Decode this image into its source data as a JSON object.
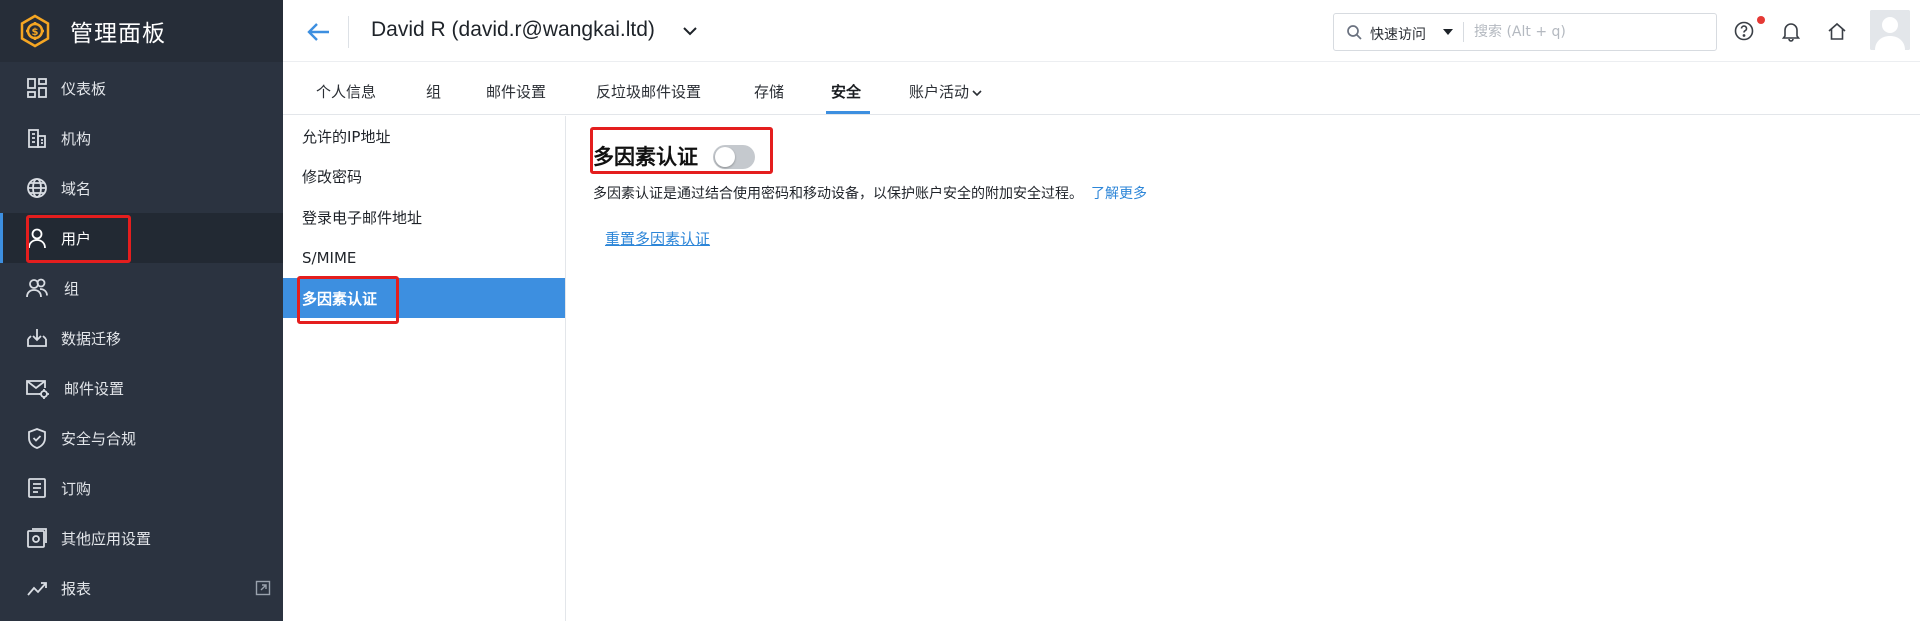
{
  "brand": {
    "title": "管理面板",
    "icon": "admin-panel-gear-icon",
    "accent": "#f5a623"
  },
  "sidebar": {
    "items": [
      {
        "label": "仪表板",
        "icon": "dashboard-icon"
      },
      {
        "label": "机构",
        "icon": "building-icon"
      },
      {
        "label": "域名",
        "icon": "globe-icon"
      },
      {
        "label": "用户",
        "icon": "user-icon",
        "active": true
      },
      {
        "label": "组",
        "icon": "group-icon"
      },
      {
        "label": "数据迁移",
        "icon": "download-tray-icon"
      },
      {
        "label": "邮件设置",
        "icon": "mail-settings-icon"
      },
      {
        "label": "安全与合规",
        "icon": "shield-check-icon"
      },
      {
        "label": "订购",
        "icon": "subscription-doc-icon"
      },
      {
        "label": "其他应用设置",
        "icon": "app-settings-icon"
      },
      {
        "label": "报表",
        "icon": "trend-chart-icon",
        "external_icon": "external-link-icon"
      }
    ]
  },
  "header": {
    "user_title": "David R (david.r@wangkai.ltd)",
    "quick_access_label": "快速访问",
    "search_placeholder": "搜索 (Alt + q)",
    "icons": [
      "help-icon",
      "bell-icon",
      "home-icon",
      "avatar"
    ]
  },
  "tabs": {
    "items": [
      {
        "label": "个人信息"
      },
      {
        "label": "组"
      },
      {
        "label": "邮件设置"
      },
      {
        "label": "反垃圾邮件设置"
      },
      {
        "label": "存储"
      },
      {
        "label": "安全",
        "active": true
      },
      {
        "label": "账户活动",
        "dropdown": true
      }
    ]
  },
  "submenu": {
    "items": [
      {
        "label": "允许的IP地址"
      },
      {
        "label": "修改密码"
      },
      {
        "label": "登录电子邮件地址"
      },
      {
        "label": "S/MIME"
      },
      {
        "label": "多因素认证",
        "active": true
      }
    ]
  },
  "main": {
    "title": "多因素认证",
    "toggle_on": false,
    "description": "多因素认证是通过结合使用密码和移动设备，以保护账户安全的附加安全过程。",
    "learn_more": "了解更多",
    "reset_link": "重置多因素认证"
  },
  "colors": {
    "sidebar_bg": "#2b3340",
    "accent_blue": "#3d8fe0",
    "link_blue": "#2d86d8",
    "highlight_red": "#e41e1e"
  }
}
